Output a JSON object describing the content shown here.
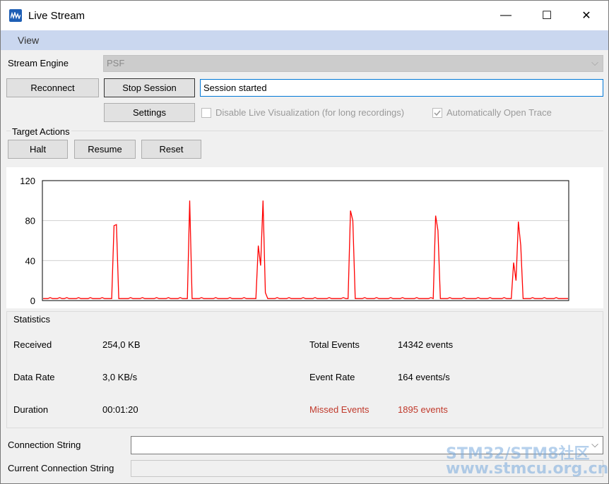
{
  "window": {
    "title": "Live Stream",
    "icon": "waveform-app-icon"
  },
  "titlebar_buttons": {
    "minimize": "—",
    "maximize": "☐",
    "close": "✕"
  },
  "menu": {
    "view": "View"
  },
  "stream_engine": {
    "label": "Stream Engine",
    "value": "PSF"
  },
  "buttons": {
    "reconnect": "Reconnect",
    "stop_session": "Stop Session",
    "settings": "Settings"
  },
  "session_status": "Session started",
  "options": {
    "disable_live_viz": {
      "label": "Disable Live Visualization (for long recordings)",
      "checked": false
    },
    "auto_open_trace": {
      "label": "Automatically Open Trace",
      "checked": true
    }
  },
  "target_actions": {
    "label": "Target Actions",
    "halt": "Halt",
    "resume": "Resume",
    "reset": "Reset"
  },
  "chart_data": {
    "type": "line",
    "ylim": [
      0,
      120
    ],
    "yticks": [
      "120",
      "80",
      "40",
      "0"
    ],
    "line_color": "#ff0000",
    "grid": true,
    "series": [
      {
        "values": [
          2,
          2,
          2,
          3,
          2,
          2,
          2,
          3,
          2,
          2,
          3,
          2,
          2,
          2,
          2,
          3,
          2,
          2,
          2,
          2,
          3,
          2,
          2,
          2,
          2,
          3,
          2,
          2,
          2,
          2,
          75,
          76,
          2,
          2,
          2,
          2,
          2,
          3,
          2,
          2,
          2,
          2,
          3,
          2,
          2,
          2,
          2,
          2,
          3,
          2,
          2,
          2,
          2,
          3,
          2,
          2,
          2,
          2,
          3,
          2,
          2,
          2,
          100,
          2,
          2,
          2,
          2,
          3,
          2,
          2,
          2,
          2,
          2,
          3,
          2,
          2,
          2,
          2,
          2,
          3,
          2,
          2,
          2,
          2,
          2,
          3,
          2,
          2,
          2,
          2,
          2,
          55,
          35,
          100,
          8,
          2,
          2,
          2,
          2,
          3,
          2,
          2,
          2,
          2,
          3,
          2,
          2,
          2,
          2,
          2,
          3,
          2,
          2,
          2,
          2,
          3,
          2,
          2,
          2,
          2,
          2,
          3,
          2,
          2,
          2,
          2,
          2,
          3,
          2,
          2,
          90,
          80,
          2,
          2,
          2,
          2,
          3,
          2,
          2,
          2,
          2,
          3,
          2,
          2,
          2,
          2,
          2,
          3,
          2,
          2,
          2,
          2,
          3,
          2,
          2,
          2,
          2,
          2,
          3,
          2,
          2,
          2,
          2,
          2,
          3,
          2,
          85,
          70,
          2,
          2,
          2,
          2,
          3,
          2,
          2,
          2,
          2,
          2,
          3,
          2,
          2,
          2,
          2,
          2,
          3,
          2,
          2,
          2,
          2,
          3,
          2,
          2,
          2,
          2,
          2,
          3,
          2,
          2,
          2,
          38,
          20,
          79,
          55,
          2,
          2,
          2,
          2,
          3,
          2,
          2,
          2,
          2,
          3,
          2,
          2,
          2,
          2,
          3,
          2,
          2,
          2,
          2,
          2
        ]
      }
    ]
  },
  "statistics": {
    "label": "Statistics",
    "received": {
      "label": "Received",
      "value": "254,0 KB"
    },
    "data_rate": {
      "label": "Data Rate",
      "value": "3,0 KB/s"
    },
    "duration": {
      "label": "Duration",
      "value": "00:01:20"
    },
    "total_events": {
      "label": "Total Events",
      "value": "14342 events"
    },
    "event_rate": {
      "label": "Event Rate",
      "value": "164 events/s"
    },
    "missed_events": {
      "label": "Missed Events",
      "value": "1895 events"
    }
  },
  "colors": {
    "missed": "#c0392b",
    "menubar": "#cad7ef",
    "accent": "#0078d7"
  },
  "connection": {
    "label": "Connection String",
    "value": "",
    "current_label": "Current Connection String",
    "current_value": ""
  },
  "watermark": {
    "line1": "STM32/STM8社区",
    "line2": "www.stmcu.org.cn"
  }
}
